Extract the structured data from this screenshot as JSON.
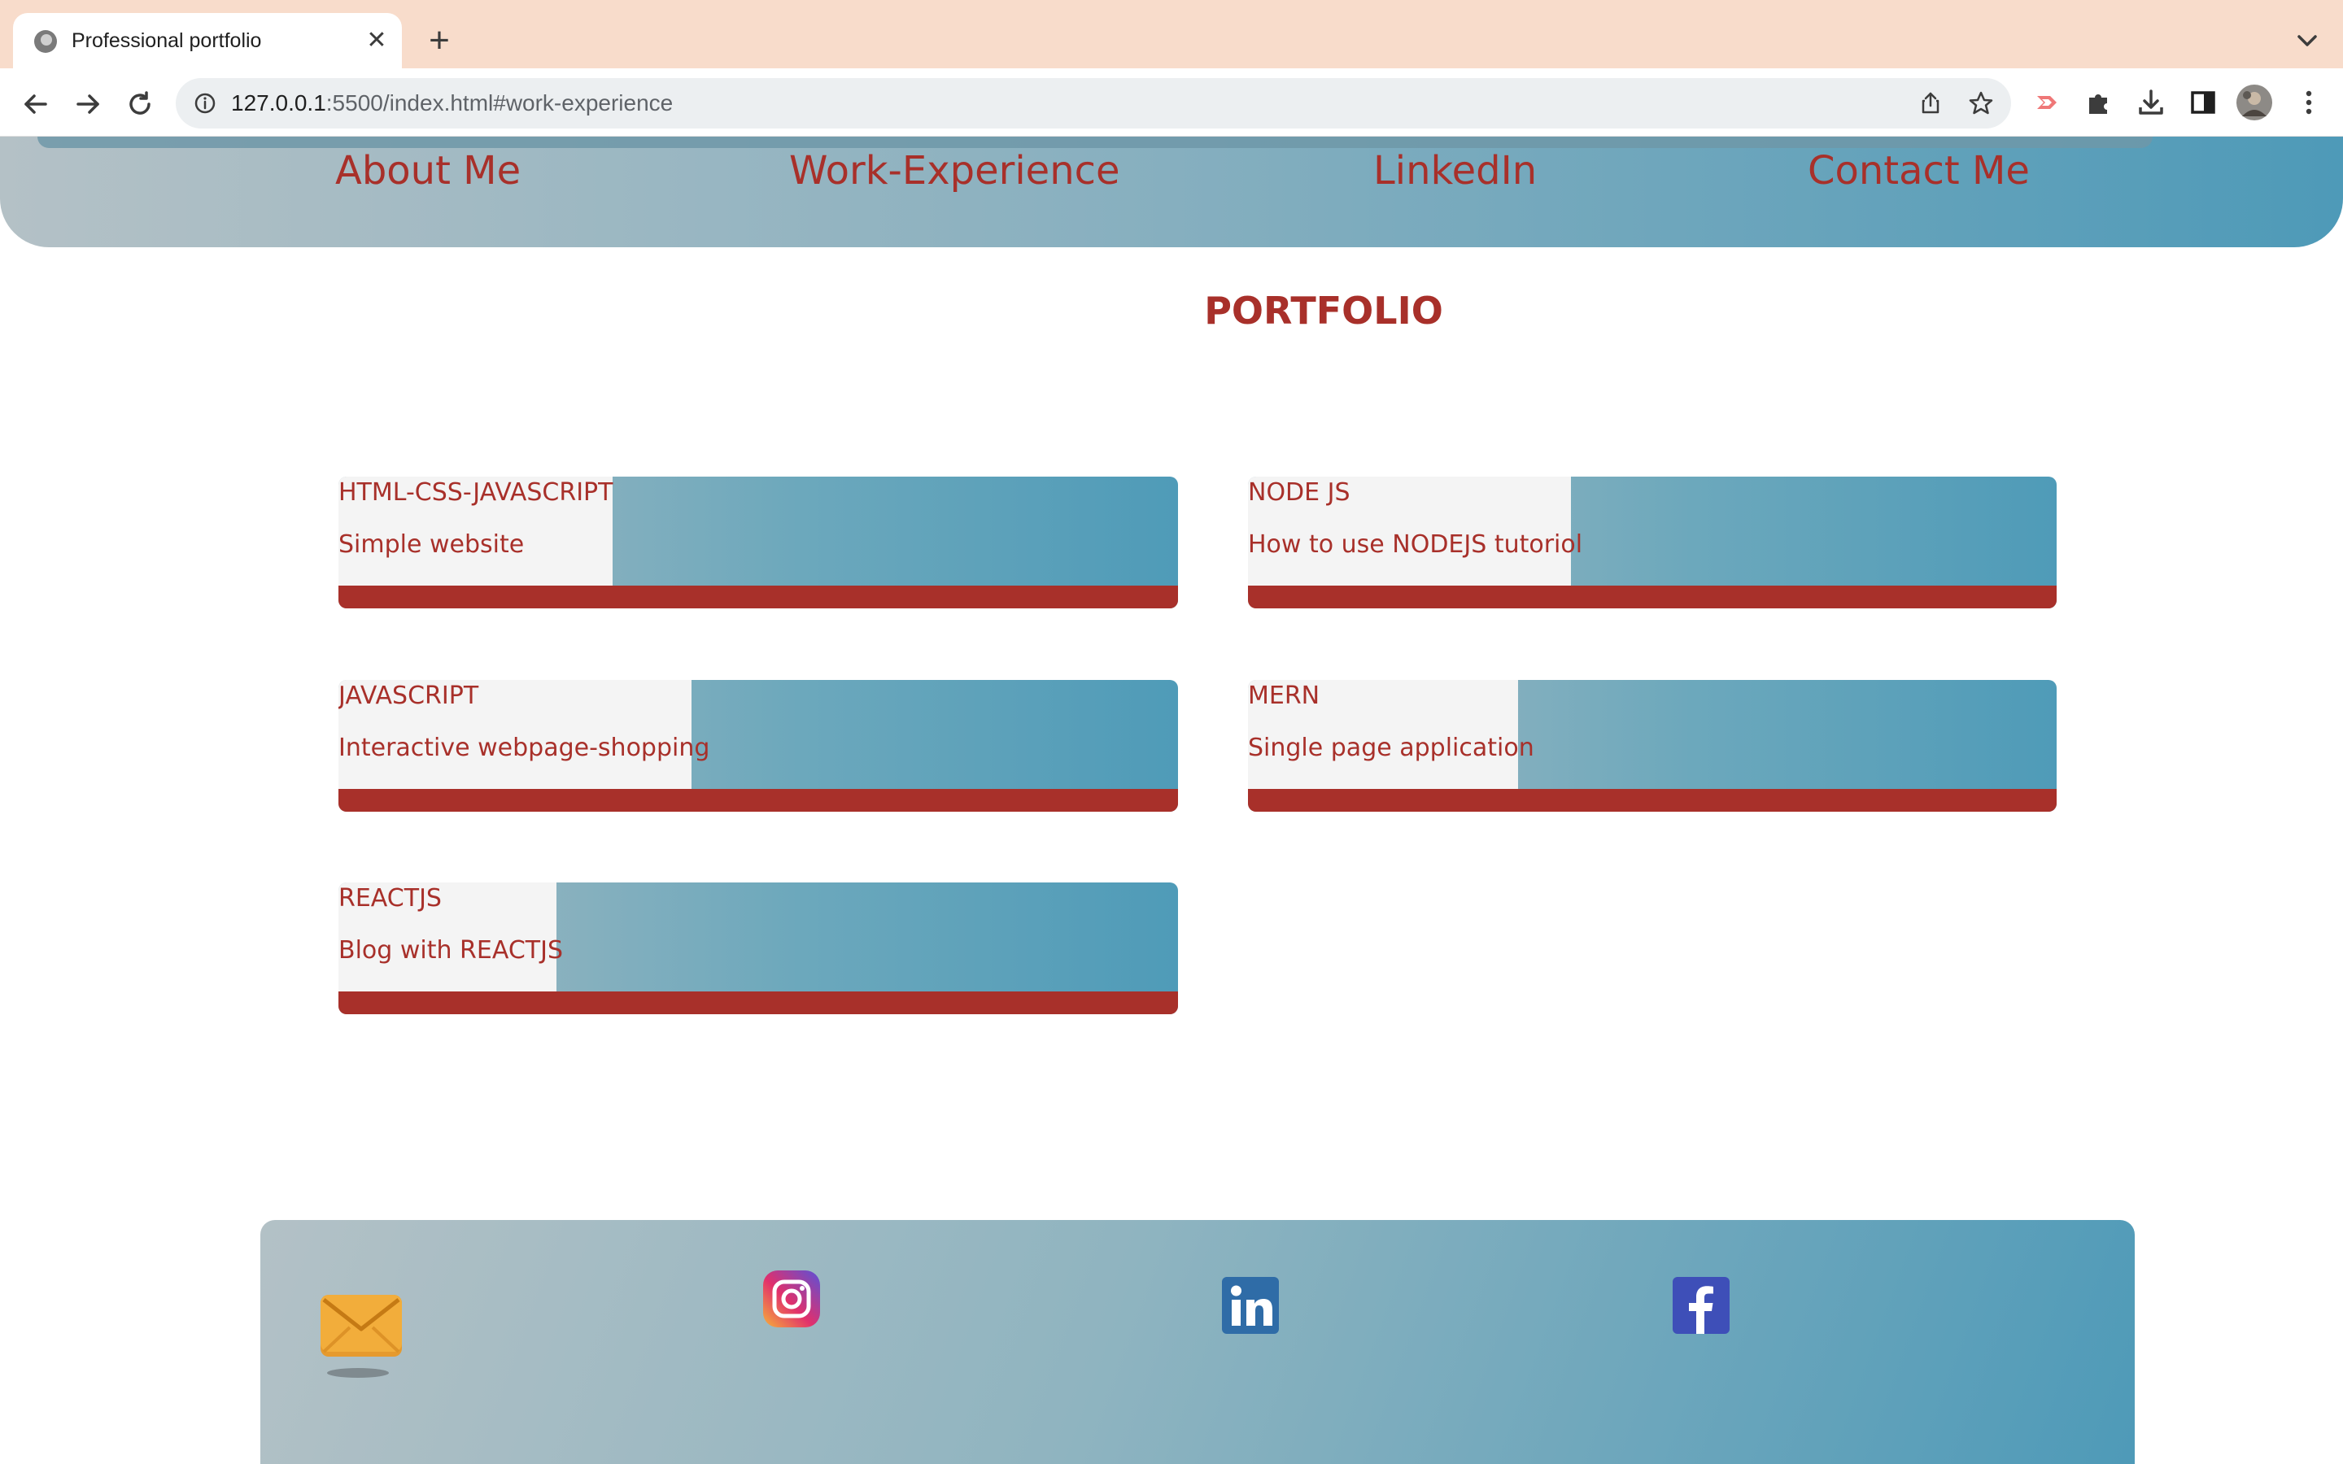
{
  "browser": {
    "tab_title": "Professional portfolio",
    "new_tab_symbol": "+",
    "close_symbol": "✕",
    "url_host": "127.0.0.1",
    "url_rest": ":5500/index.html#work-experience"
  },
  "nav": {
    "links": [
      "About Me",
      "Work-Experience",
      "LinkedIn",
      "Contact Me"
    ]
  },
  "portfolio": {
    "title": "PORTFOLIO",
    "cards": [
      {
        "title": "HTML-CSS-JAVASCRIPT",
        "description": "Simple website"
      },
      {
        "title": "NODE JS",
        "description": "How to use NODEJS tutoriol"
      },
      {
        "title": "JAVASCRIPT",
        "description": "Interactive webpage-shopping"
      },
      {
        "title": "MERN",
        "description": "Single page application"
      },
      {
        "title": "REACTJS",
        "description": "Blog with REACTJS"
      }
    ]
  },
  "footer": {
    "icons": [
      "mail-icon",
      "instagram-icon",
      "linkedin-icon",
      "facebook-icon"
    ]
  },
  "colors": {
    "accent": "#a8302a",
    "gradient_start": "#b4c1c6",
    "gradient_end": "#4e9ab8",
    "tabstrip": "#f8dccb"
  }
}
